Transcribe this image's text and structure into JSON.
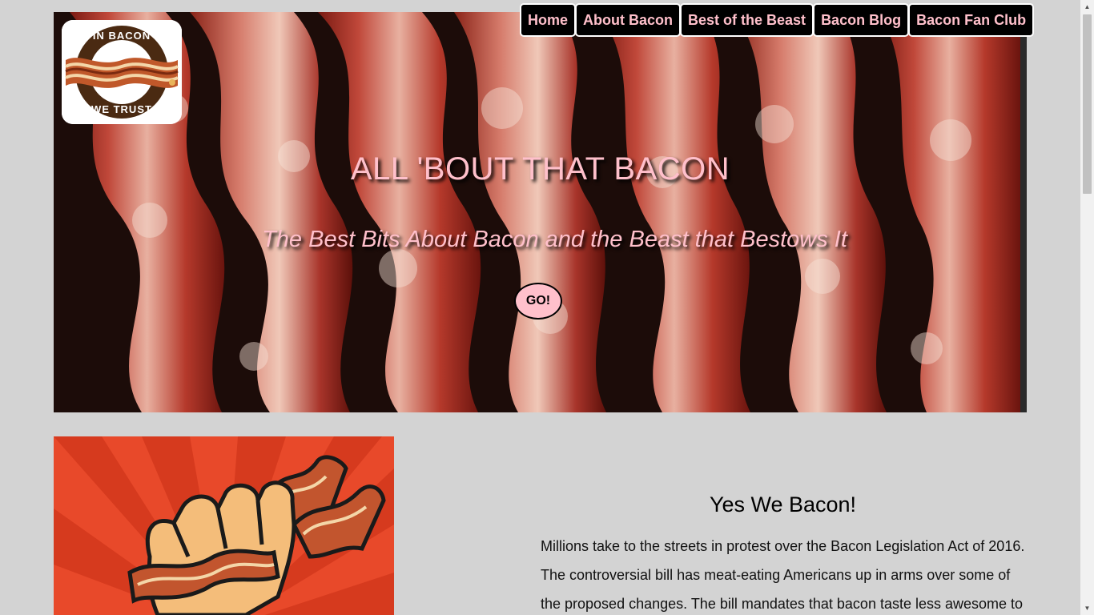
{
  "logo": {
    "text_top": "IN BACON",
    "text_bottom": "WE TRUST"
  },
  "nav": {
    "items": [
      {
        "label": "Home"
      },
      {
        "label": "About Bacon"
      },
      {
        "label": "Best of the Beast"
      },
      {
        "label": "Bacon Blog"
      },
      {
        "label": "Bacon Fan Club"
      }
    ]
  },
  "hero": {
    "title": "ALL 'BOUT THAT BACON",
    "subtitle": "The Best Bits About Bacon and the Beast that Bestows It",
    "go_label": "GO!"
  },
  "feature": {
    "heading": "Yes We Bacon!",
    "body": "Millions take to the streets in protest over the Bacon Legislation Act of 2016. The controversial bill has meat-eating Americans up in arms over some of the proposed changes. The bill mandates that bacon taste less awesome to"
  },
  "colors": {
    "accent_pink": "#ffc0cb",
    "nav_bg": "#000000",
    "page_bg": "#d3d3d3",
    "poster_red": "#e8492a"
  },
  "icons": {
    "scroll_up": "chevron-up-icon",
    "scroll_down": "chevron-down-icon"
  }
}
